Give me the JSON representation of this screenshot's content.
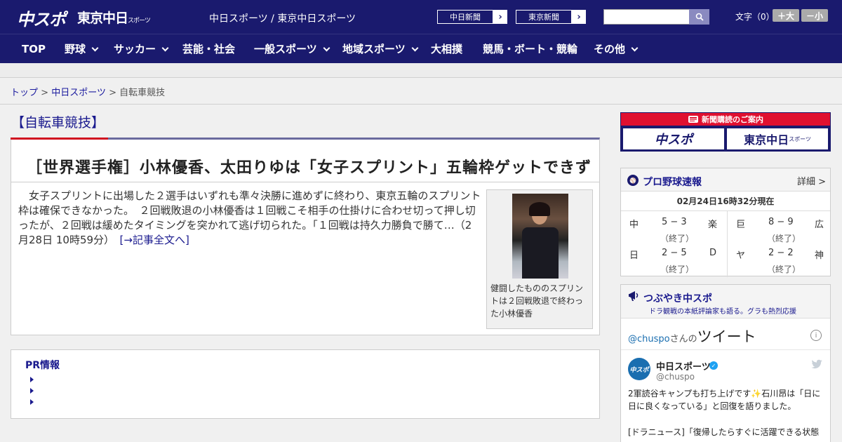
{
  "header": {
    "logo_chuspo": "中スポ",
    "logo_tokyo": "東京中日",
    "logo_tokyo_small": "スポーツ",
    "sites": "中日スポーツ / 東京中日スポーツ",
    "ext_links": [
      "中日新聞",
      "東京新聞"
    ],
    "font_size_label": "文字（0）",
    "font_bigger": "＋大",
    "font_smaller": "－小"
  },
  "nav": {
    "items": [
      {
        "label": "TOP",
        "dropdown": false
      },
      {
        "label": "野球",
        "dropdown": true
      },
      {
        "label": "サッカー",
        "dropdown": true
      },
      {
        "label": "芸能・社会",
        "dropdown": false
      },
      {
        "label": "一般スポーツ",
        "dropdown": true
      },
      {
        "label": "地域スポーツ",
        "dropdown": true
      },
      {
        "label": "大相撲",
        "dropdown": false
      },
      {
        "label": "競馬・ボート・競輪",
        "dropdown": false
      },
      {
        "label": "その他",
        "dropdown": true
      }
    ]
  },
  "breadcrumb": {
    "top": "トップ",
    "sep": ">",
    "chunichi": "中日スポーツ",
    "current": "自転車競技"
  },
  "page_heading": "【自転車競技】",
  "article": {
    "title": "［世界選手権］小林優香、太田りゆは「女子スプリント」五輪枠ゲットできず",
    "body": "　女子スプリントに出場した２選手はいずれも準々決勝に進めずに終わり、東京五輪のスプリント枠は確保できなかった。　２回戦敗退の小林優香は１回戦こそ相手の仕掛けに合わせ切って押し切ったが、２回戦は緩めたタイミングを突かれて逃げ切られた。「１回戦は持久力勝負で勝て…（2月28日 10時59分）　",
    "read_more": "[→記事全文へ]",
    "photo_caption": "健闘したもののスプリントは２回戦敗退で終わった小林優香"
  },
  "pr": {
    "title": "PR情報",
    "items": [
      "",
      "",
      ""
    ]
  },
  "sidebar": {
    "subscribe": {
      "banner": "新聞購読のご案内",
      "logo_a": "中スポ",
      "logo_b": "東京中日",
      "logo_b_small": "スポーツ"
    },
    "baseball": {
      "title": "プロ野球速報",
      "detail": "詳細 >",
      "updated": "02月24日16時32分現在",
      "games": [
        {
          "home": "中",
          "score": "5 − 3",
          "away": "楽",
          "status": "（終了）"
        },
        {
          "home": "巨",
          "score": "8 − 9",
          "away": "広",
          "status": "（終了）"
        },
        {
          "home": "日",
          "score": "2 − 5",
          "away": "D",
          "status": "（終了）"
        },
        {
          "home": "ヤ",
          "score": "2 − 2",
          "away": "神",
          "status": "（終了）"
        }
      ]
    },
    "tweets": {
      "title": "つぶやき中スポ",
      "subtitle": "ドラ観戦の本紙評論家も語る。グラも熱烈応援",
      "handle": "@chuspo",
      "handle_suffix": "さんの",
      "tweet_word": "ツイート",
      "avatar_text": "中スポ",
      "name": "中日スポーツ",
      "at": "@chuspo",
      "text1": "2軍読谷キャンプも打ち上げです✨石川昂は「日に日に良くなっている」と回復を語りました。",
      "text2": "[ドラニュース]「復帰したらすぐに活躍できる状態"
    }
  },
  "colors": {
    "brand_navy": "#1a1a6e",
    "accent_red": "#d01020",
    "link": "#1a1a9e"
  }
}
